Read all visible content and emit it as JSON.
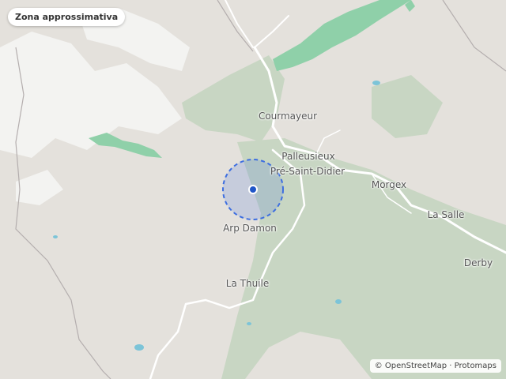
{
  "badge": {
    "label": "Zona approssimativa"
  },
  "places": {
    "courmayeur": "Courmayeur",
    "palleusieux": "Palleusieux",
    "pre_saint_didier": "Pré-Saint-Didier",
    "morgex": "Morgex",
    "la_salle": "La Salle",
    "arp_damon": "Arp Damon",
    "la_thuile": "La Thuile",
    "derby": "Derby"
  },
  "attribution": {
    "prefix": "©",
    "osm": "OpenStreetMap",
    "separator": "·",
    "protomaps": "Protomaps"
  },
  "colors": {
    "land": "#e4e1dc",
    "forest": "#c8d6c3",
    "park": "#8fd0a9",
    "glacier": "#f3f3f1",
    "water": "#7cc4d8",
    "road": "#ffffff",
    "marker": "#1f56c8",
    "marker_zone": "#3d6ee0"
  },
  "icons": {
    "location": "location-marker-icon",
    "zone": "approximate-zone-circle"
  }
}
